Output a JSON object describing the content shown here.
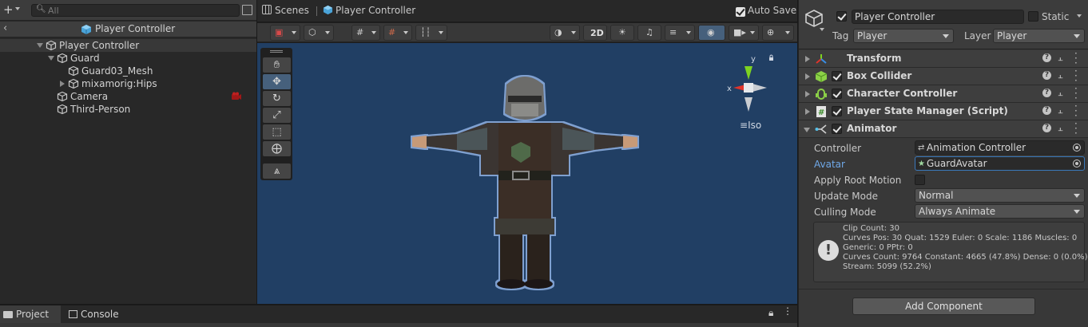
{
  "hierarchy": {
    "search_placeholder": "All",
    "header_title": "Player Controller",
    "rows": [
      {
        "label": "Player Controller"
      },
      {
        "label": "Guard"
      },
      {
        "label": "Guard03_Mesh"
      },
      {
        "label": "mixamorig:Hips"
      },
      {
        "label": "Camera"
      },
      {
        "label": "Third-Person"
      }
    ]
  },
  "scene": {
    "tab_scenes": "Scenes",
    "tab_prefab": "Player Controller",
    "auto_save_label": "Auto Save",
    "auto_save_checked": true,
    "toolbar_2d_label": "2D",
    "gizmo_y_label": "y",
    "gizmo_x_label": "x",
    "iso_label": "Iso"
  },
  "inspector": {
    "object_name": "Player Controller",
    "static_label": "Static",
    "tag_label": "Tag",
    "tag_value": "Player",
    "layer_label": "Layer",
    "layer_value": "Player",
    "components": [
      {
        "name": "Transform",
        "icon": "transform-icon"
      },
      {
        "name": "Box Collider",
        "icon": "box-collider-icon",
        "enabled": true
      },
      {
        "name": "Character Controller",
        "icon": "character-controller-icon",
        "enabled": true
      },
      {
        "name": "Player State Manager (Script)",
        "icon": "script-icon",
        "enabled": true
      },
      {
        "name": "Animator",
        "icon": "animator-icon",
        "enabled": true
      }
    ],
    "animator": {
      "controller_label": "Controller",
      "controller_value": "Animation Controller",
      "avatar_label": "Avatar",
      "avatar_value": "GuardAvatar",
      "apply_root_motion_label": "Apply Root Motion",
      "update_mode_label": "Update Mode",
      "update_mode_value": "Normal",
      "culling_mode_label": "Culling Mode",
      "culling_mode_value": "Always Animate",
      "info_lines": [
        "Clip Count: 30",
        "Curves Pos: 30 Quat: 1529 Euler: 0 Scale: 1186 Muscles: 0",
        "Generic: 0 PPtr: 0",
        "Curves Count: 9764 Constant: 4665 (47.8%) Dense: 0 (0.0%)",
        "Stream: 5099 (52.2%)"
      ]
    },
    "add_component_label": "Add Component"
  },
  "bottom": {
    "tab_project": "Project",
    "tab_console": "Console"
  },
  "colors": {
    "viewport_bg": "#213f64",
    "selection_blue": "#46607c",
    "avatar_label_blue": "#6fa8e8"
  }
}
